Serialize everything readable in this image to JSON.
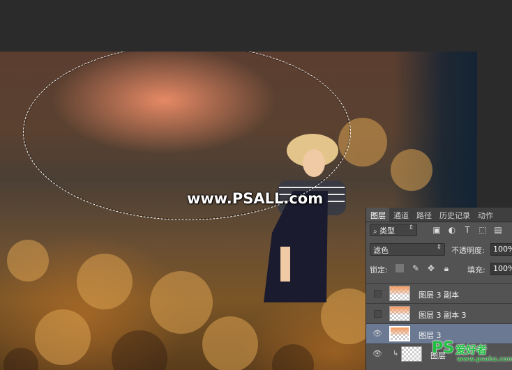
{
  "watermark": "www.PSALL.com",
  "layers_panel": {
    "tabs": [
      "图层",
      "通道",
      "路径",
      "历史记录",
      "动作"
    ],
    "filter": {
      "label": "类型"
    },
    "blend_mode": "滤色",
    "opacity_label": "不透明度:",
    "opacity_value": "100%",
    "lock_label": "锁定:",
    "fill_label": "填充:",
    "fill_value": "100%",
    "layers": [
      {
        "name": "图层 3 副本",
        "visible": false
      },
      {
        "name": "图层 3 副本 3",
        "visible": false
      },
      {
        "name": "图层 3",
        "visible": true,
        "selected": true
      },
      {
        "name": "图层",
        "visible": true
      }
    ]
  },
  "site_logo": {
    "ps": "PS",
    "cn": "爱好者",
    "url": "www.psahz.com"
  },
  "colors": {
    "selected_layer": "#6b7a92",
    "panel_bg": "#535353",
    "logo_green": "#1fbf3f"
  }
}
